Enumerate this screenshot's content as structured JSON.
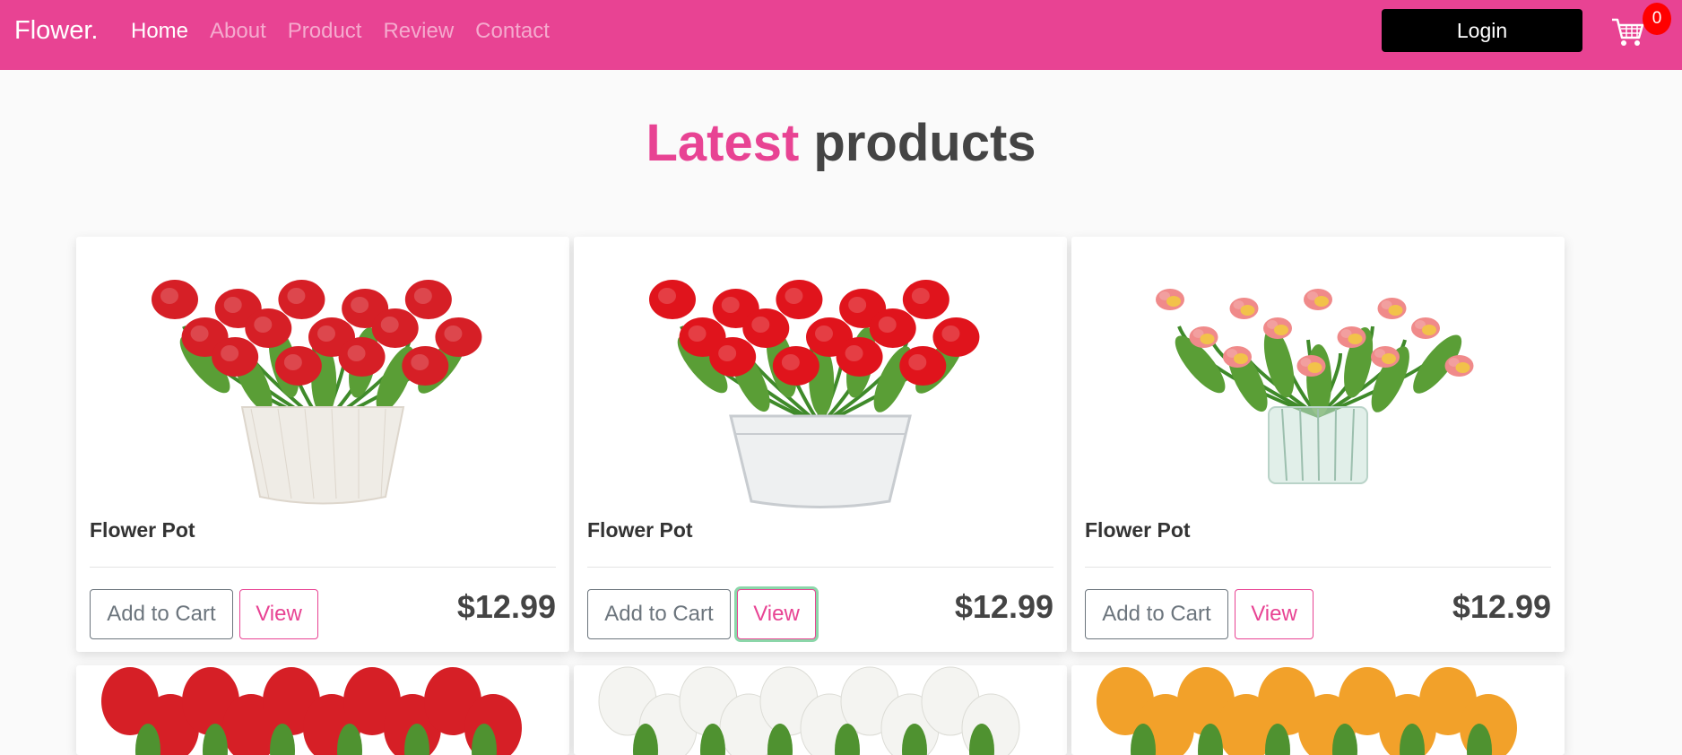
{
  "nav": {
    "brand": "Flower.",
    "links": [
      {
        "label": "Home",
        "active": true
      },
      {
        "label": "About",
        "active": false
      },
      {
        "label": "Product",
        "active": false
      },
      {
        "label": "Review",
        "active": false
      },
      {
        "label": "Contact",
        "active": false
      }
    ],
    "login_label": "Login",
    "cart_count": "0"
  },
  "heading": {
    "accent": "Latest",
    "rest": "products"
  },
  "products": [
    {
      "title": "Flower Pot",
      "price": "$12.99",
      "add_label": "Add to Cart",
      "view_label": "View",
      "flower_color": "#d61f26",
      "vase": "ceramic"
    },
    {
      "title": "Flower Pot",
      "price": "$12.99",
      "add_label": "Add to Cart",
      "view_label": "View",
      "flower_color": "#e0141c",
      "vase": "tin"
    },
    {
      "title": "Flower Pot",
      "price": "$12.99",
      "add_label": "Add to Cart",
      "view_label": "View",
      "flower_color": "#f08a8a",
      "vase": "glass"
    }
  ],
  "colors": {
    "brand": "#e84393",
    "badge": "#ff0000"
  }
}
